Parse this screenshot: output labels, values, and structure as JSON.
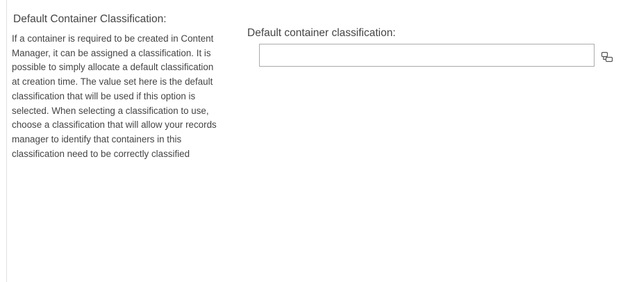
{
  "section": {
    "title": "Default Container Classification:",
    "description": "If a container is required to be created in Content Manager, it can be assigned a classification. It is possible to simply allocate a default classification at creation time. The value set here is the default classification that will be used if this option is selected. When selecting a classification to use, choose a classification that will allow your records manager to identify that containers in this classification need to be correctly classified"
  },
  "field": {
    "label": "Default container classification:",
    "value": "",
    "browse_icon": "browse-icon"
  },
  "colors": {
    "text": "#444444",
    "input_border": "#ababab",
    "divider": "#e1e1e1"
  }
}
